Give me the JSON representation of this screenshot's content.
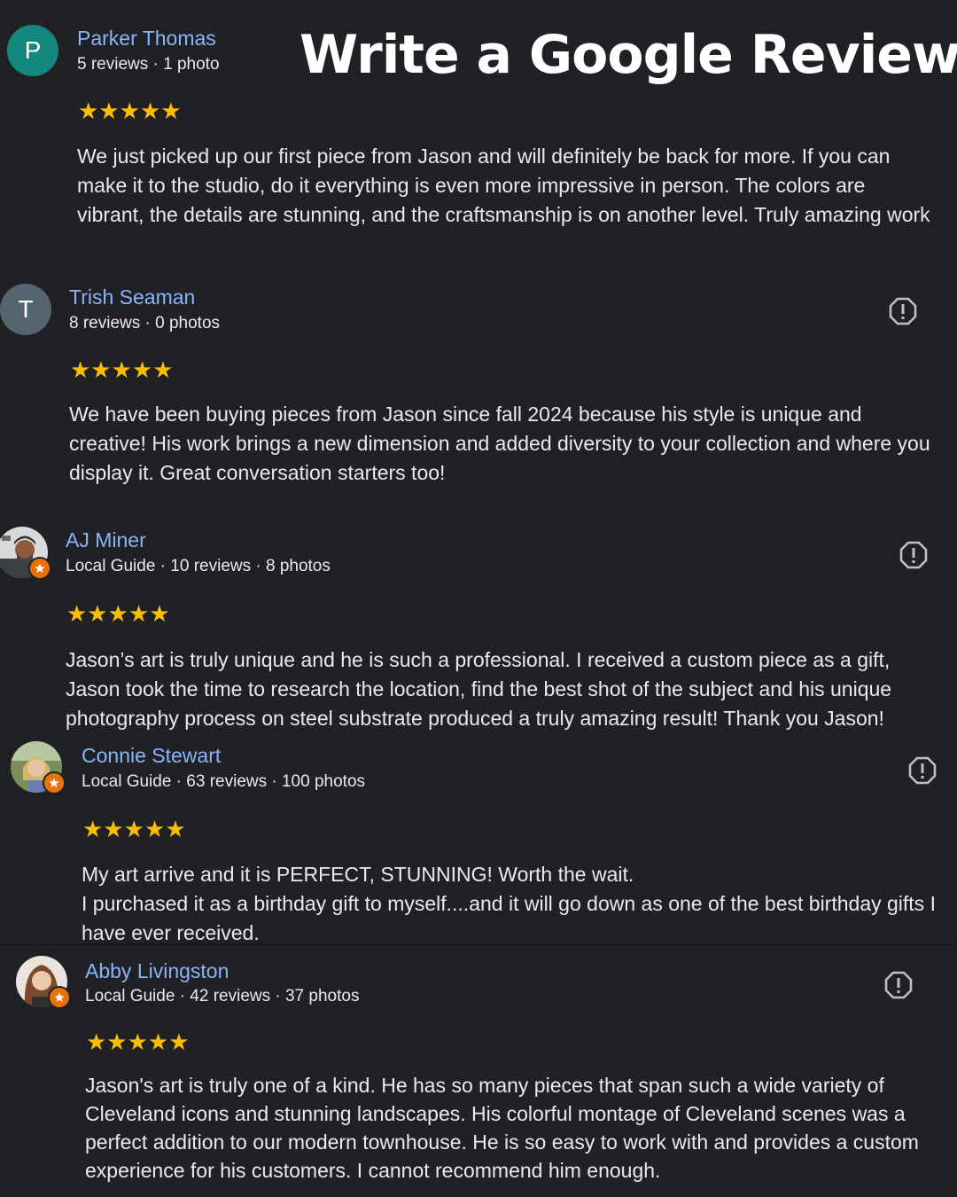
{
  "page_title": "Write a Google Review",
  "colors": {
    "background": "#202124",
    "name": "#8ab4f8",
    "star": "#fbbc04",
    "guide_badge": "#e8710a"
  },
  "reviews": [
    {
      "name": "Parker Thomas",
      "avatar_letter": "P",
      "avatar_color": "#12897c",
      "meta": "5 reviews · 1 photo",
      "stars": "★★★★★",
      "text": "We just picked up our first piece from Jason and will definitely be back for more. If you can make it to the studio, do it everything is even more impressive in person. The colors are vibrant, the details are stunning, and the craftsmanship is on another level. Truly amazing work"
    },
    {
      "name": "Trish Seaman",
      "avatar_letter": "T",
      "avatar_color": "#54656f",
      "meta": "8 reviews · 0 photos",
      "stars": "★★★★★",
      "text": "We have been buying pieces from Jason since fall 2024 because his style is unique and creative! His work brings a new dimension and added diversity to your collection and where you display it. Great conversation starters too!"
    },
    {
      "name": "AJ Miner",
      "meta": "Local Guide · 10 reviews · 8 photos",
      "stars": "★★★★★",
      "text": "Jason’s art is truly unique and he is such a professional. I received a custom piece as a gift, Jason took the time to research the location, find the best shot of the subject and his unique photography process on steel substrate produced a truly amazing result! Thank you Jason!"
    },
    {
      "name": "Connie Stewart",
      "meta": "Local Guide · 63 reviews · 100 photos",
      "stars": "★★★★★",
      "text": "My art arrive and it is PERFECT, STUNNING! Worth the wait.\nI purchased it as a birthday gift to myself....and it will go down as one of the best birthday gifts I have ever received."
    },
    {
      "name": "Abby Livingston",
      "meta": "Local Guide · 42 reviews · 37 photos",
      "stars": "★★★★★",
      "text": "Jason's art is truly one of a kind. He has so many pieces that span such a wide variety of Cleveland icons and stunning landscapes. His colorful montage of Cleveland scenes was a perfect addition to our modern townhouse. He is so easy to work with and provides a custom experience for his customers. I cannot recommend him enough."
    }
  ]
}
